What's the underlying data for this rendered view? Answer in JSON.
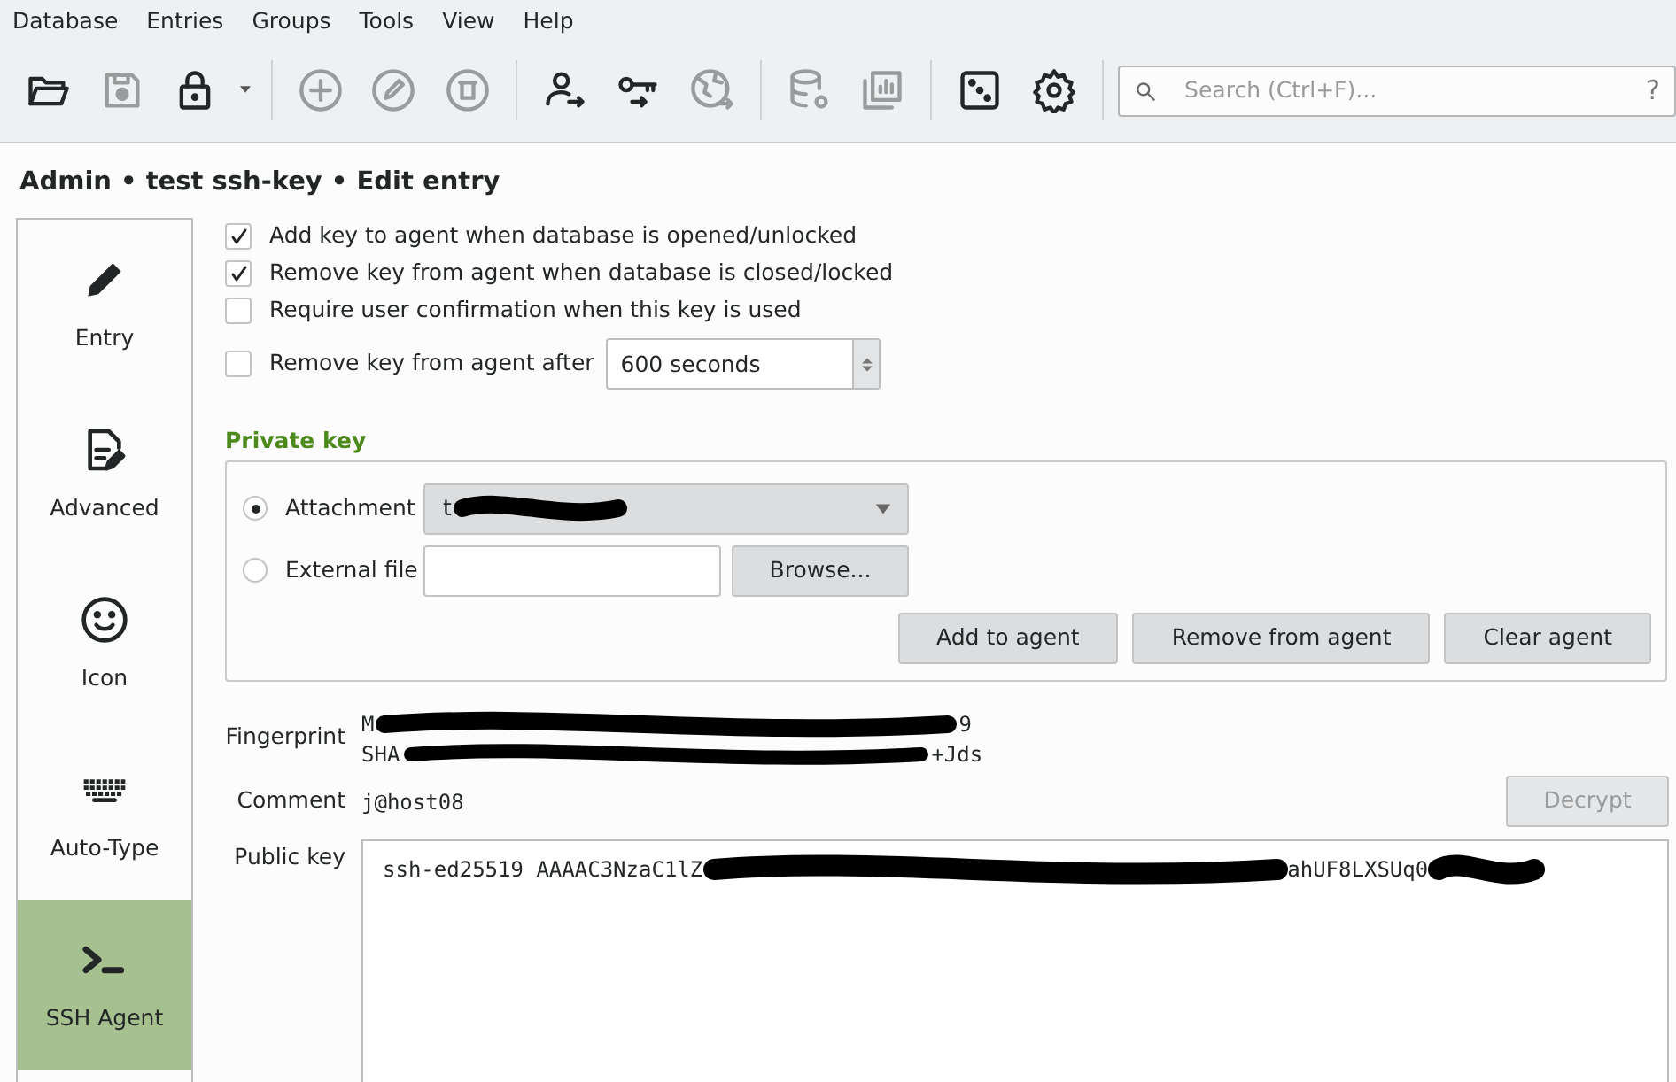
{
  "menu": [
    "Database",
    "Entries",
    "Groups",
    "Tools",
    "View",
    "Help"
  ],
  "toolbar": {
    "groups": [
      [
        {
          "disabled": false
        },
        {
          "disabled": true
        },
        {
          "disabled": false,
          "kind": "dropdown"
        }
      ],
      [
        {
          "disabled": true
        },
        {
          "disabled": true
        },
        {
          "disabled": true
        }
      ],
      [
        {
          "disabled": false
        },
        {
          "disabled": false
        },
        {
          "disabled": true
        }
      ],
      [
        {
          "disabled": true
        },
        {
          "disabled": true
        }
      ],
      [
        {
          "disabled": false
        },
        {
          "disabled": false
        }
      ]
    ],
    "search": {
      "placeholder": "Search (Ctrl+F)...",
      "help": "?"
    }
  },
  "title": "Admin • test ssh-key • Edit entry",
  "sidebar": {
    "items": [
      {
        "label": "Entry",
        "selected": false
      },
      {
        "label": "Advanced",
        "selected": false
      },
      {
        "label": "Icon",
        "selected": false
      },
      {
        "label": "Auto-Type",
        "selected": false
      },
      {
        "label": "SSH Agent",
        "selected": true
      }
    ]
  },
  "options": [
    {
      "label": "Add key to agent when database is opened/unlocked",
      "checked": true
    },
    {
      "label": "Remove key from agent when database is closed/locked",
      "checked": true
    },
    {
      "label": "Require user confirmation when this key is used",
      "checked": false
    },
    {
      "label": "Remove key from agent after",
      "checked": false,
      "value": "600 seconds"
    }
  ],
  "private_key": {
    "title": "Private key",
    "sources": [
      {
        "label": "Attachment",
        "selected": true,
        "kind": "select",
        "value": "t"
      },
      {
        "label": "External file",
        "selected": false,
        "kind": "file",
        "button": "Browse..."
      }
    ],
    "buttons": [
      "Add to agent",
      "Remove from agent",
      "Clear agent"
    ]
  },
  "fingerprint": {
    "label": "Fingerprint",
    "lines": [
      {
        "start": "M",
        "end": "9"
      },
      {
        "start": "SHA",
        "end": "+Jds"
      }
    ]
  },
  "comment": {
    "label": "Comment",
    "value": "j@host08",
    "button": "Decrypt",
    "button_disabled": true
  },
  "public_key": {
    "label": "Public key",
    "start": "ssh-ed25519 AAAAC3NzaC1lZ",
    "end": "ahUF8LXSUq0"
  }
}
